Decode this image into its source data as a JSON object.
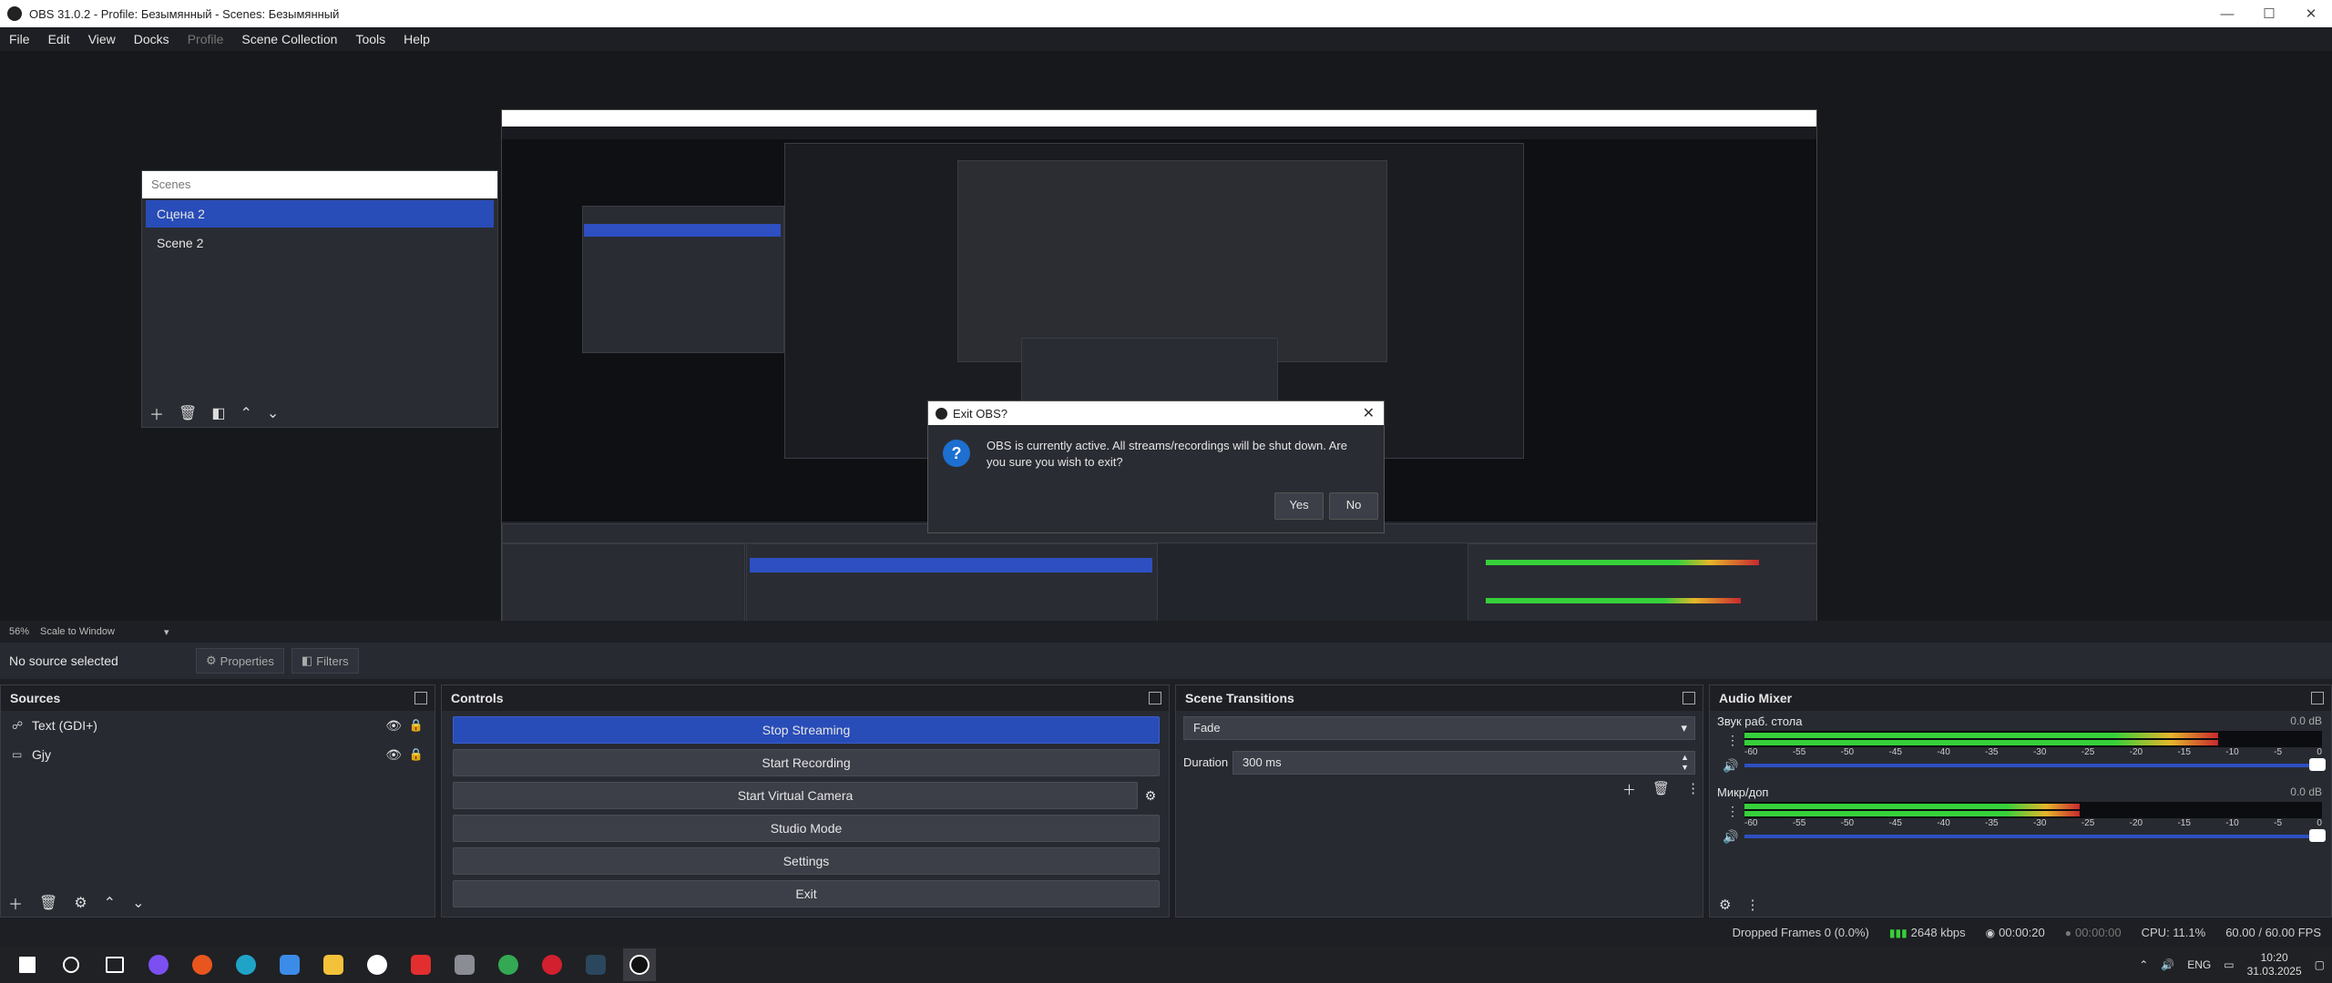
{
  "window": {
    "title": "OBS 31.0.2 - Profile: Безымянный - Scenes: Безымянный"
  },
  "menu": [
    "File",
    "Edit",
    "View",
    "Docks",
    "Profile",
    "Scene Collection",
    "Tools",
    "Help"
  ],
  "menu_disabled": "Profile",
  "scenes": {
    "header": "Scenes",
    "items": [
      "Сцена 2",
      "Scene 2"
    ],
    "selected": 0
  },
  "dialog": {
    "title": "Exit OBS?",
    "message": "OBS is currently active. All streams/recordings will be shut down. Are you sure you wish to exit?",
    "yes": "Yes",
    "no": "No"
  },
  "scale": {
    "zoom": "56%",
    "mode": "Scale to Window"
  },
  "source_toolbar": {
    "no_source": "No source selected",
    "properties": "Properties",
    "filters": "Filters"
  },
  "sources": {
    "title": "Sources",
    "items": [
      {
        "name": "Text (GDI+)",
        "icon": "text-icon"
      },
      {
        "name": "Gjy",
        "icon": "monitor-icon"
      }
    ]
  },
  "controls": {
    "title": "Controls",
    "stop_streaming": "Stop Streaming",
    "start_recording": "Start Recording",
    "start_virtual_camera": "Start Virtual Camera",
    "studio_mode": "Studio Mode",
    "settings": "Settings",
    "exit": "Exit"
  },
  "transitions": {
    "title": "Scene Transitions",
    "selected": "Fade",
    "duration_label": "Duration",
    "duration_value": "300 ms"
  },
  "mixer": {
    "title": "Audio Mixer",
    "channels": [
      {
        "name": "Звук раб. стола",
        "db": "0.0 dB",
        "level": 0.82
      },
      {
        "name": "Микр/доп",
        "db": "0.0 dB",
        "level": 0.58
      }
    ],
    "ticks": [
      "-60",
      "-55",
      "-50",
      "-45",
      "-40",
      "-35",
      "-30",
      "-25",
      "-20",
      "-15",
      "-10",
      "-5",
      "0"
    ]
  },
  "status": {
    "dropped": "Dropped Frames 0 (0.0%)",
    "bitrate": "2648 kbps",
    "stream_time": "00:00:20",
    "rec_time": "00:00:00",
    "cpu": "CPU: 11.1%",
    "fps": "60.00 / 60.00 FPS"
  },
  "tray": {
    "lang": "ENG",
    "time": "10:20",
    "date": "31.03.2025"
  },
  "colors": {
    "accent": "#284cb8",
    "dock_bg": "#272a31",
    "window_bg": "#1e1f24",
    "meter_green": "#36d03a",
    "meter_yellow": "#e6b62a",
    "meter_red": "#c8292f"
  }
}
